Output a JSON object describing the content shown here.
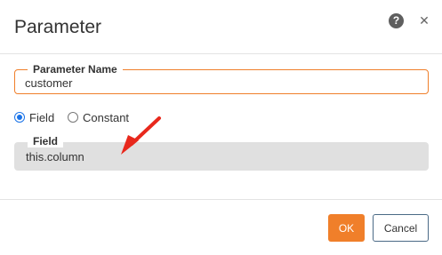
{
  "dialog": {
    "title": "Parameter",
    "help_icon": "help-icon",
    "help_glyph": "?",
    "close_icon": "close-icon",
    "close_glyph": "✕"
  },
  "parameter_name": {
    "label": "Parameter Name",
    "value": "customer"
  },
  "source_type": {
    "options": [
      {
        "label": "Field",
        "selected": true
      },
      {
        "label": "Constant",
        "selected": false
      }
    ]
  },
  "field": {
    "label": "Field",
    "value": "this.column",
    "disabled": true
  },
  "annotation": {
    "icon": "red-arrow-icon",
    "color": "#e8281c"
  },
  "footer": {
    "ok_label": "OK",
    "cancel_label": "Cancel"
  },
  "colors": {
    "accent": "#f07f2a",
    "radio": "#1a73e8",
    "disabled_field": "#e0e0e0",
    "cancel_border": "#4b6a86"
  }
}
